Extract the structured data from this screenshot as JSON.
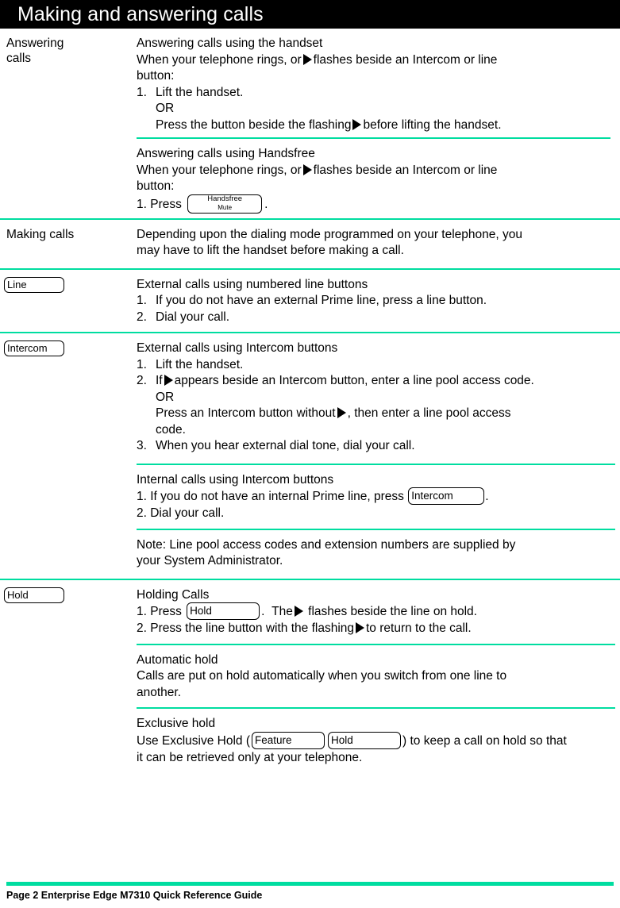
{
  "header": {
    "title": "Making and answering calls"
  },
  "sections": [
    {
      "label": "Answering\ncalls",
      "label_line1": "Answering",
      "label_line2": "calls",
      "left_key": null,
      "blocks": [
        {
          "heading": "Answering calls using the handset",
          "intro_a": "When your telephone rings, or",
          "intro_b": "flashes beside an Intercom or line",
          "intro_c": "button:",
          "steps": [
            {
              "num": "1.",
              "text": "Lift the handset."
            },
            {
              "num": "",
              "text": "OR"
            },
            {
              "num": "",
              "text_a": "Press the button beside the flashing",
              "text_b": "before lifting the handset."
            }
          ]
        },
        {
          "heading": "Answering calls using Handsfree",
          "intro_a": "When your telephone rings, or",
          "intro_b": "flashes beside an Intercom or line",
          "intro_c": "button:",
          "press_label": "1.  Press",
          "key_line1": "Handsfree",
          "key_line2": "Mute",
          "trailing": "."
        }
      ]
    },
    {
      "label_line1": "Making calls",
      "label_line2": "",
      "paragraph_line1": "Depending upon the dialing mode programmed on your telephone, you",
      "paragraph_line2": "may have to lift the handset before making a call."
    },
    {
      "left_key": "Line",
      "heading": "External calls using numbered line buttons",
      "steps": [
        {
          "num": "1.",
          "text": "If you do not have an external Prime line, press a line button."
        },
        {
          "num": "2.",
          "text": "Dial your call."
        }
      ]
    },
    {
      "left_key": "Intercom",
      "heading": "External calls using Intercom buttons",
      "steps": [
        {
          "num": "1.",
          "text": "Lift the handset."
        },
        {
          "num": "2.",
          "text_a": "If",
          "text_b": "appears beside an Intercom button, enter a line pool access code."
        },
        {
          "num": "",
          "text": "OR"
        },
        {
          "num": "",
          "text_a": "Press an Intercom button without",
          "text_b": ", then enter a line pool access"
        },
        {
          "num": "",
          "text": "code."
        },
        {
          "num": "3.",
          "text": "When you hear external dial tone, dial your call."
        }
      ]
    },
    {
      "heading": "Internal calls using Intercom buttons",
      "step1_a": "1.  If you do not have an internal Prime line, press",
      "step1_key": "Intercom",
      "step1_b": ".",
      "step2": "2.  Dial your call."
    },
    {
      "note_line1": "Note: Line pool access codes and extension numbers are supplied by",
      "note_line2": "your System Administrator."
    },
    {
      "left_key": "Hold",
      "heading": "Holding Calls",
      "step1_a": "1.  Press",
      "step1_key": "Hold",
      "step1_b": ".",
      "step1_c": "The",
      "step1_d": "flashes beside the line on hold.",
      "step2_a": "2.  Press the line button with the flashing",
      "step2_b": "to return to the call."
    },
    {
      "heading": "Automatic hold",
      "body_line1": "Calls are put on hold automatically when you switch from one line to",
      "body_line2": "another."
    },
    {
      "heading": "Exclusive hold",
      "body_a": "Use Exclusive Hold (",
      "key1": "Feature",
      "key2": "Hold",
      "body_b": ") to keep a call on hold so that",
      "body_line2": "it can be retrieved only at your telephone."
    }
  ],
  "footer": {
    "text": "Page 2 Enterprise Edge M7310 Quick Reference Guide"
  },
  "colors": {
    "accent": "#00dda0",
    "header_bg": "#000000",
    "text": "#000000"
  },
  "icons": {
    "indicator": "triangle-right-icon"
  }
}
